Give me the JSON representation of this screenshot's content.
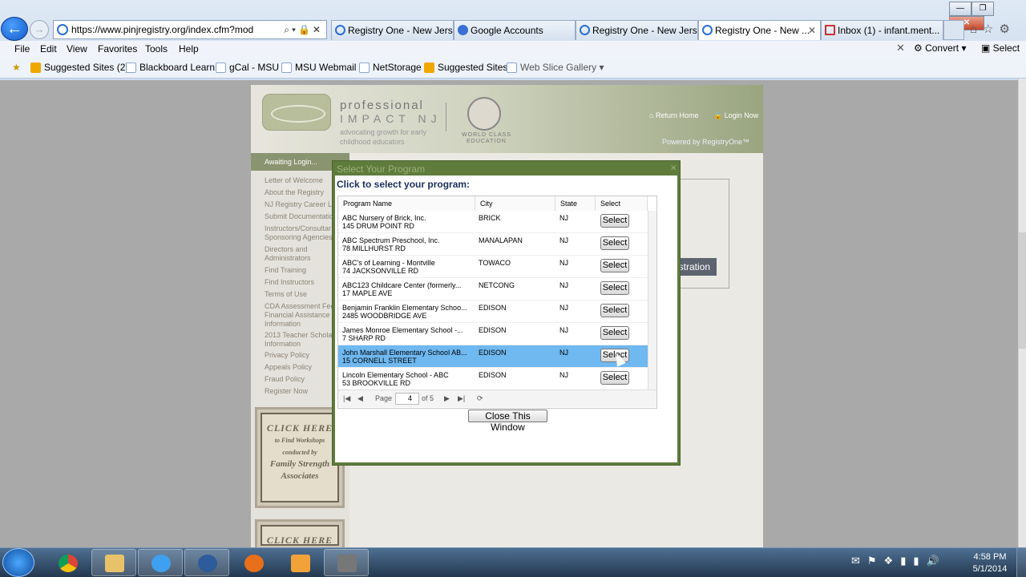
{
  "browser": {
    "url": "https://www.pinjregistry.org/index.cfm?mod",
    "tabs": [
      {
        "label": "Registry One - New Jers..."
      },
      {
        "label": "Google Accounts"
      },
      {
        "label": "Registry One - New Jers..."
      },
      {
        "label": "Registry One - New ..."
      },
      {
        "label": "Inbox (1) - infant.ment..."
      }
    ],
    "menu": [
      "File",
      "Edit",
      "View",
      "Favorites",
      "Tools",
      "Help"
    ],
    "favorites": [
      "Suggested Sites (2)",
      "Blackboard Learn",
      "gCal - MSU",
      "MSU Webmail",
      "NetStorage",
      "Suggested Sites",
      "Web Slice Gallery"
    ],
    "convert_label": "Convert",
    "select_label": "Select"
  },
  "site": {
    "brand_line1": "professional",
    "brand_line2": "IMPACT NJ",
    "tagline": "advocating growth for early childhood educators",
    "seal_text": "WORLD CLASS EDUCATION",
    "return_home": "Return Home",
    "login_now": "Login Now",
    "powered_by": "Powered by RegistryOne™",
    "awaiting": "Awaiting Login...",
    "nav": [
      "Letter of Welcome",
      "About the Registry",
      "NJ Registry Career La",
      "Submit Documentatio",
      "Instructors/Consultar Sponsoring Agencies",
      "Directors and Administrators",
      "Find Training",
      "Find Instructors",
      "Terms of Use",
      "CDA Assessment Fee Financial Assistance Information",
      "2013 Teacher Scholar Information",
      "Privacy Policy",
      "Appeals Policy",
      "Fraud Policy",
      "Register Now"
    ],
    "ad1": {
      "t1": "CLICK HERE",
      "t2": "to Find Workshops conducted by",
      "t3": "Family Strength Associates"
    },
    "ad2": {
      "t1": "CLICK HERE"
    },
    "registration_btn": "istration"
  },
  "modal": {
    "title": "Select Your Program",
    "heading": "Click to select your program:",
    "columns": [
      "Program Name",
      "City",
      "State",
      "Select"
    ],
    "rows": [
      {
        "name": "ABC Nursery of Brick, Inc.",
        "address": "145 DRUM POINT RD",
        "city": "BRICK",
        "state": "NJ",
        "select": "Select"
      },
      {
        "name": "ABC Spectrum Preschool, Inc.",
        "address": "78 MILLHURST RD",
        "city": "MANALAPAN",
        "state": "NJ",
        "select": "Select"
      },
      {
        "name": "ABC's of Learning - Montville",
        "address": "74 JACKSONVILLE RD",
        "city": "TOWACO",
        "state": "NJ",
        "select": "Select"
      },
      {
        "name": "ABC123 Childcare Center (formerly...",
        "address": "17 MAPLE AVE",
        "city": "NETCONG",
        "state": "NJ",
        "select": "Select"
      },
      {
        "name": "Benjamin Franklin Elementary Schoo...",
        "address": "2485 WOODBRIDGE AVE",
        "city": "EDISON",
        "state": "NJ",
        "select": "Select"
      },
      {
        "name": "James Monroe Elementary School -...",
        "address": "7 SHARP RD",
        "city": "EDISON",
        "state": "NJ",
        "select": "Select"
      },
      {
        "name": "John Marshall Elementary School AB...",
        "address": "15 CORNELL STREET",
        "city": "EDISON",
        "state": "NJ",
        "select": "Select"
      },
      {
        "name": "Lincoln Elementary School - ABC",
        "address": "53 BROOKVILLE RD",
        "city": "EDISON",
        "state": "NJ",
        "select": "Select"
      }
    ],
    "pager": {
      "page_label": "Page",
      "page": "4",
      "of_label": "of 5"
    },
    "close_label": "Close This Window"
  },
  "taskbar": {
    "time": "4:58 PM",
    "date": "5/1/2014"
  }
}
